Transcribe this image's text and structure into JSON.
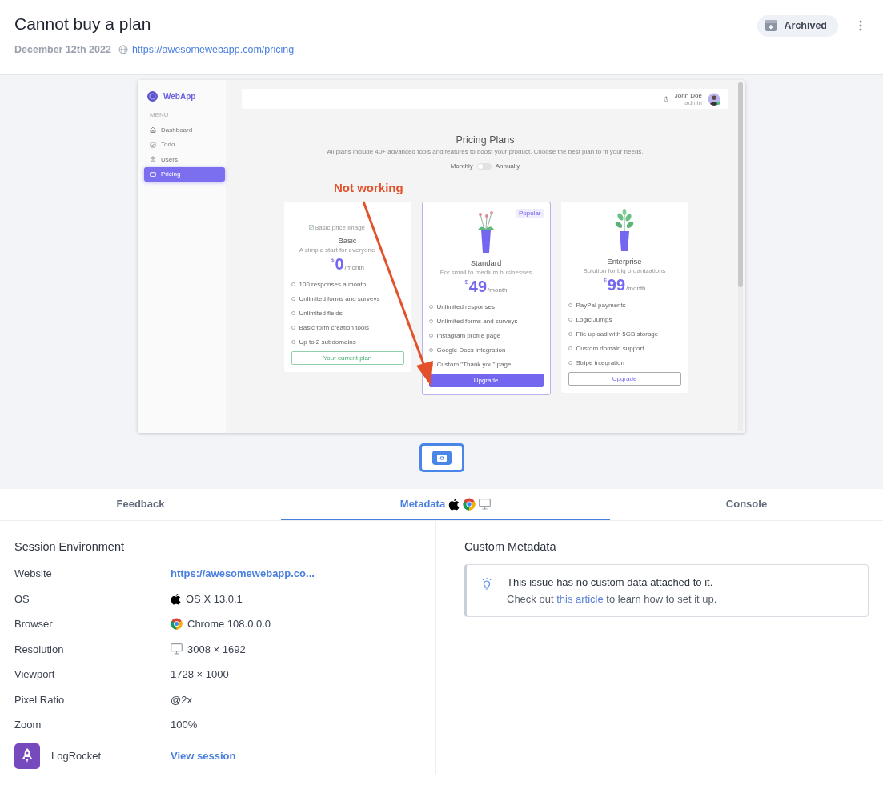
{
  "issue": {
    "title": "Cannot buy a plan",
    "date": "December 12th 2022",
    "url": "https://awesomewebapp.com/pricing",
    "status": "Archived"
  },
  "screenshot": {
    "app_name": "WebApp",
    "menu_heading": "MENU",
    "menu": [
      {
        "label": "Dashboard",
        "kind": "home",
        "selected": false
      },
      {
        "label": "Todo",
        "kind": "todo",
        "selected": false
      },
      {
        "label": "Users",
        "kind": "user",
        "selected": false
      },
      {
        "label": "Pricing",
        "kind": "card",
        "selected": true
      }
    ],
    "user": {
      "name": "John Doe",
      "role": "admin"
    },
    "title": "Pricing Plans",
    "subtitle": "All plans include 40+ advanced tools and features to boost your product. Choose the best plan to fit your needs.",
    "billing": {
      "left": "Monthly",
      "right": "Annually",
      "on": false
    },
    "plans": [
      {
        "name": "Basic",
        "tagline": "A simple start for everyone",
        "currency": "$",
        "price": "0",
        "period": "/month",
        "kind": "broken",
        "image_alt": "Basic price image",
        "highlighted": false,
        "features": [
          "100 responses a month",
          "Unlimited forms and surveys",
          "Unlimited fields",
          "Basic form creation tools",
          "Up to 2 subdomains"
        ],
        "button": {
          "label": "Your current plan",
          "kind": "current"
        }
      },
      {
        "name": "Standard",
        "tagline": "For small to medium businesses",
        "currency": "$",
        "price": "49",
        "period": "/month",
        "kind": "flower",
        "badge": "Popular",
        "highlighted": true,
        "features": [
          "Unlimited responses",
          "Unlimited forms and surveys",
          "Instagram profile page",
          "Google Docs integration",
          "Custom \"Thank you\" page"
        ],
        "button": {
          "label": "Upgrade",
          "kind": "primary"
        }
      },
      {
        "name": "Enterprise",
        "tagline": "Solution for big organizations",
        "currency": "$",
        "price": "99",
        "period": "/month",
        "kind": "leafy",
        "highlighted": false,
        "features": [
          "PayPal payments",
          "Logic Jumps",
          "File upload with 5GB storage",
          "Custom domain support",
          "Stripe integration"
        ],
        "button": {
          "label": "Upgrade",
          "kind": "outline"
        }
      }
    ],
    "annotation": "Not working"
  },
  "thumbnails": [
    {
      "selected": true
    }
  ],
  "tabs": [
    {
      "label": "Feedback",
      "kind": "plain",
      "selected": false
    },
    {
      "label": "Metadata",
      "kind": "metadata",
      "selected": true
    },
    {
      "label": "Console",
      "kind": "plain",
      "selected": false
    }
  ],
  "session_environment": {
    "heading": "Session Environment",
    "rows": [
      {
        "label": "Website",
        "value": "https://awesomewebapp.co...",
        "kind": "link"
      },
      {
        "label": "OS",
        "value": "OS X 13.0.1",
        "kind": "apple"
      },
      {
        "label": "Browser",
        "value": "Chrome 108.0.0.0",
        "kind": "chrome"
      },
      {
        "label": "Resolution",
        "value": "3008 × 1692",
        "kind": "monitor"
      },
      {
        "label": "Viewport",
        "value": "1728 × 1000",
        "kind": "text"
      },
      {
        "label": "Pixel Ratio",
        "value": "@2x",
        "kind": "text"
      },
      {
        "label": "Zoom",
        "value": "100%",
        "kind": "text"
      },
      {
        "label": "LogRocket",
        "value": "View session",
        "kind": "integration"
      }
    ]
  },
  "custom_metadata": {
    "heading": "Custom Metadata",
    "message": "This issue has no custom data attached to it.",
    "hint_before": "Check out",
    "hint_link": "this article",
    "hint_after": "to learn how to set it up."
  }
}
